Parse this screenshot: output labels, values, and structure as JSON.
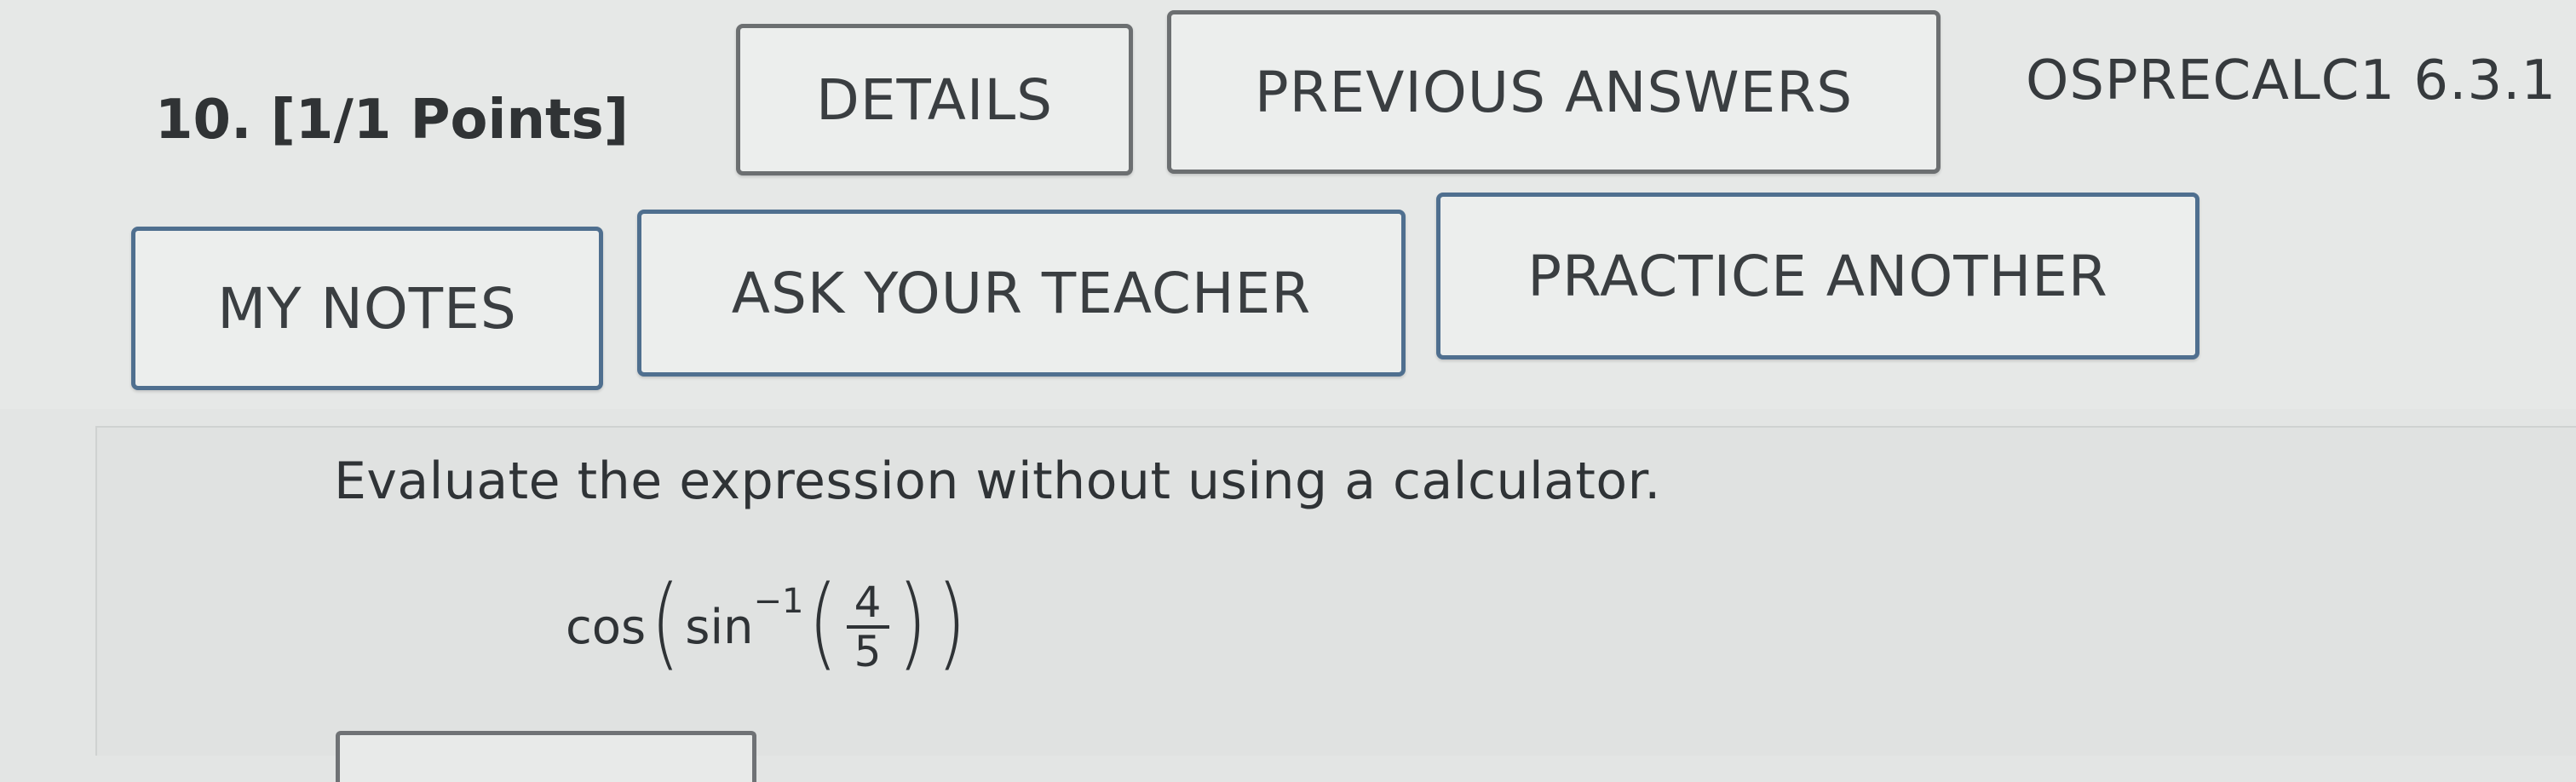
{
  "question": {
    "header": "10.  [1/1 Points]",
    "assignment_code": "OSPRECALC1 6.3.1"
  },
  "buttons": {
    "details": "DETAILS",
    "previous_answers": "PREVIOUS ANSWERS",
    "my_notes": "MY NOTES",
    "ask_teacher": "ASK YOUR TEACHER",
    "practice_another": "PRACTICE ANOTHER"
  },
  "problem": {
    "prompt": "Evaluate the expression without using a calculator.",
    "outer_function": "cos",
    "inner_function": "sin",
    "inverse_exponent": "−1",
    "numerator": "4",
    "denominator": "5"
  },
  "answer": {
    "value": ""
  }
}
